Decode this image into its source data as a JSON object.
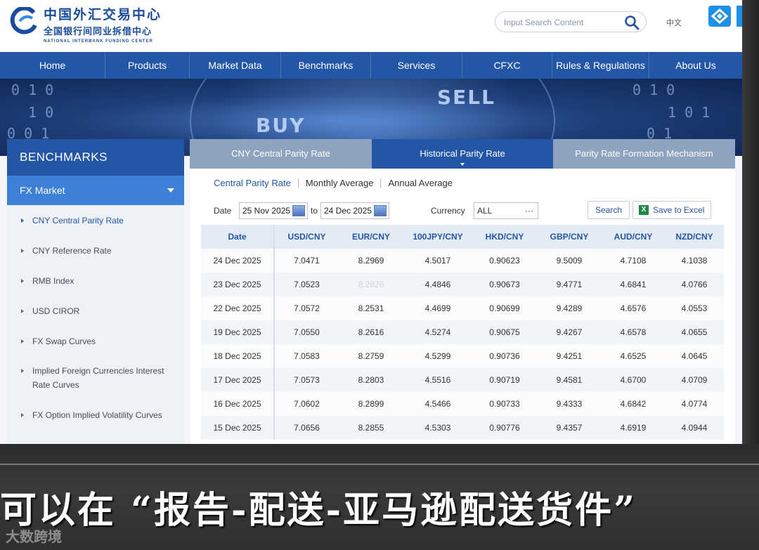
{
  "header": {
    "logo_cn": "中国外汇交易中心",
    "logo_cn2": "全国银行间同业拆借中心",
    "logo_en": "NATIONAL INTERBANK FUNDING CENTER",
    "search_placeholder": "Input Search Content",
    "lang": "中文"
  },
  "nav": [
    "Home",
    "Products",
    "Market Data",
    "Benchmarks",
    "Services",
    "CFXC",
    "Rules & Regulations",
    "About Us"
  ],
  "banner": {
    "buy": "BUY",
    "sell": "SELL"
  },
  "sidebar": {
    "title": "BENCHMARKS",
    "section": "FX Market",
    "items": [
      "CNY Central Parity Rate",
      "CNY Reference Rate",
      "RMB Index",
      "USD CIROR",
      "FX Swap Curves",
      "Implied Foreign Currencies Interest",
      "Rate Curves",
      "FX Option Implied Volatility Curves"
    ]
  },
  "tabs": [
    "CNY Central Parity Rate",
    "Historical Parity Rate",
    "Parity Rate Formation Mechanism"
  ],
  "subtabs": [
    "Central Parity Rate",
    "Monthly Average",
    "Annual Average"
  ],
  "filter": {
    "date_label": "Date",
    "from": "25 Nov 2025",
    "to_label": "to",
    "to": "24 Dec 2025",
    "currency_label": "Currency",
    "currency": "ALL",
    "currency_more": "···",
    "search": "Search",
    "excel": "Save to Excel",
    "excel_icon": "X"
  },
  "table": {
    "headers": [
      "Date",
      "USD/CNY",
      "EUR/CNY",
      "100JPY/CNY",
      "HKD/CNY",
      "GBP/CNY",
      "AUD/CNY",
      "NZD/CNY"
    ],
    "rows": [
      [
        "24 Dec 2025",
        "7.0471",
        "8.2969",
        "4.5017",
        "0.90623",
        "9.5009",
        "4.7108",
        "4.1038"
      ],
      [
        "23 Dec 2025",
        "7.0523",
        "8.2828",
        "4.4846",
        "0.90673",
        "9.4771",
        "4.6841",
        "4.0766"
      ],
      [
        "22 Dec 2025",
        "7.0572",
        "8.2531",
        "4.4699",
        "0.90699",
        "9.4289",
        "4.6576",
        "4.0553"
      ],
      [
        "19 Dec 2025",
        "7.0550",
        "8.2616",
        "4.5274",
        "0.90675",
        "9.4267",
        "4.6578",
        "4.0655"
      ],
      [
        "18 Dec 2025",
        "7.0583",
        "8.2759",
        "4.5299",
        "0.90736",
        "9.4251",
        "4.6525",
        "4.0645"
      ],
      [
        "17 Dec 2025",
        "7.0573",
        "8.2803",
        "4.5516",
        "0.90719",
        "9.4581",
        "4.6700",
        "4.0709"
      ],
      [
        "16 Dec 2025",
        "7.0602",
        "8.2899",
        "4.5466",
        "0.90733",
        "9.4333",
        "4.6842",
        "4.0774"
      ],
      [
        "15 Dec 2025",
        "7.0656",
        "8.2855",
        "4.5303",
        "0.90776",
        "9.4357",
        "4.6919",
        "4.0944"
      ]
    ]
  },
  "caption": "可以在 “报告-配送-亚马逊配送货件”",
  "watermark": "大数跨境",
  "colors": {
    "brand_blue": "#2456a6",
    "tab_inactive": "#8ea3c0",
    "section_blue": "#3d80d8"
  }
}
